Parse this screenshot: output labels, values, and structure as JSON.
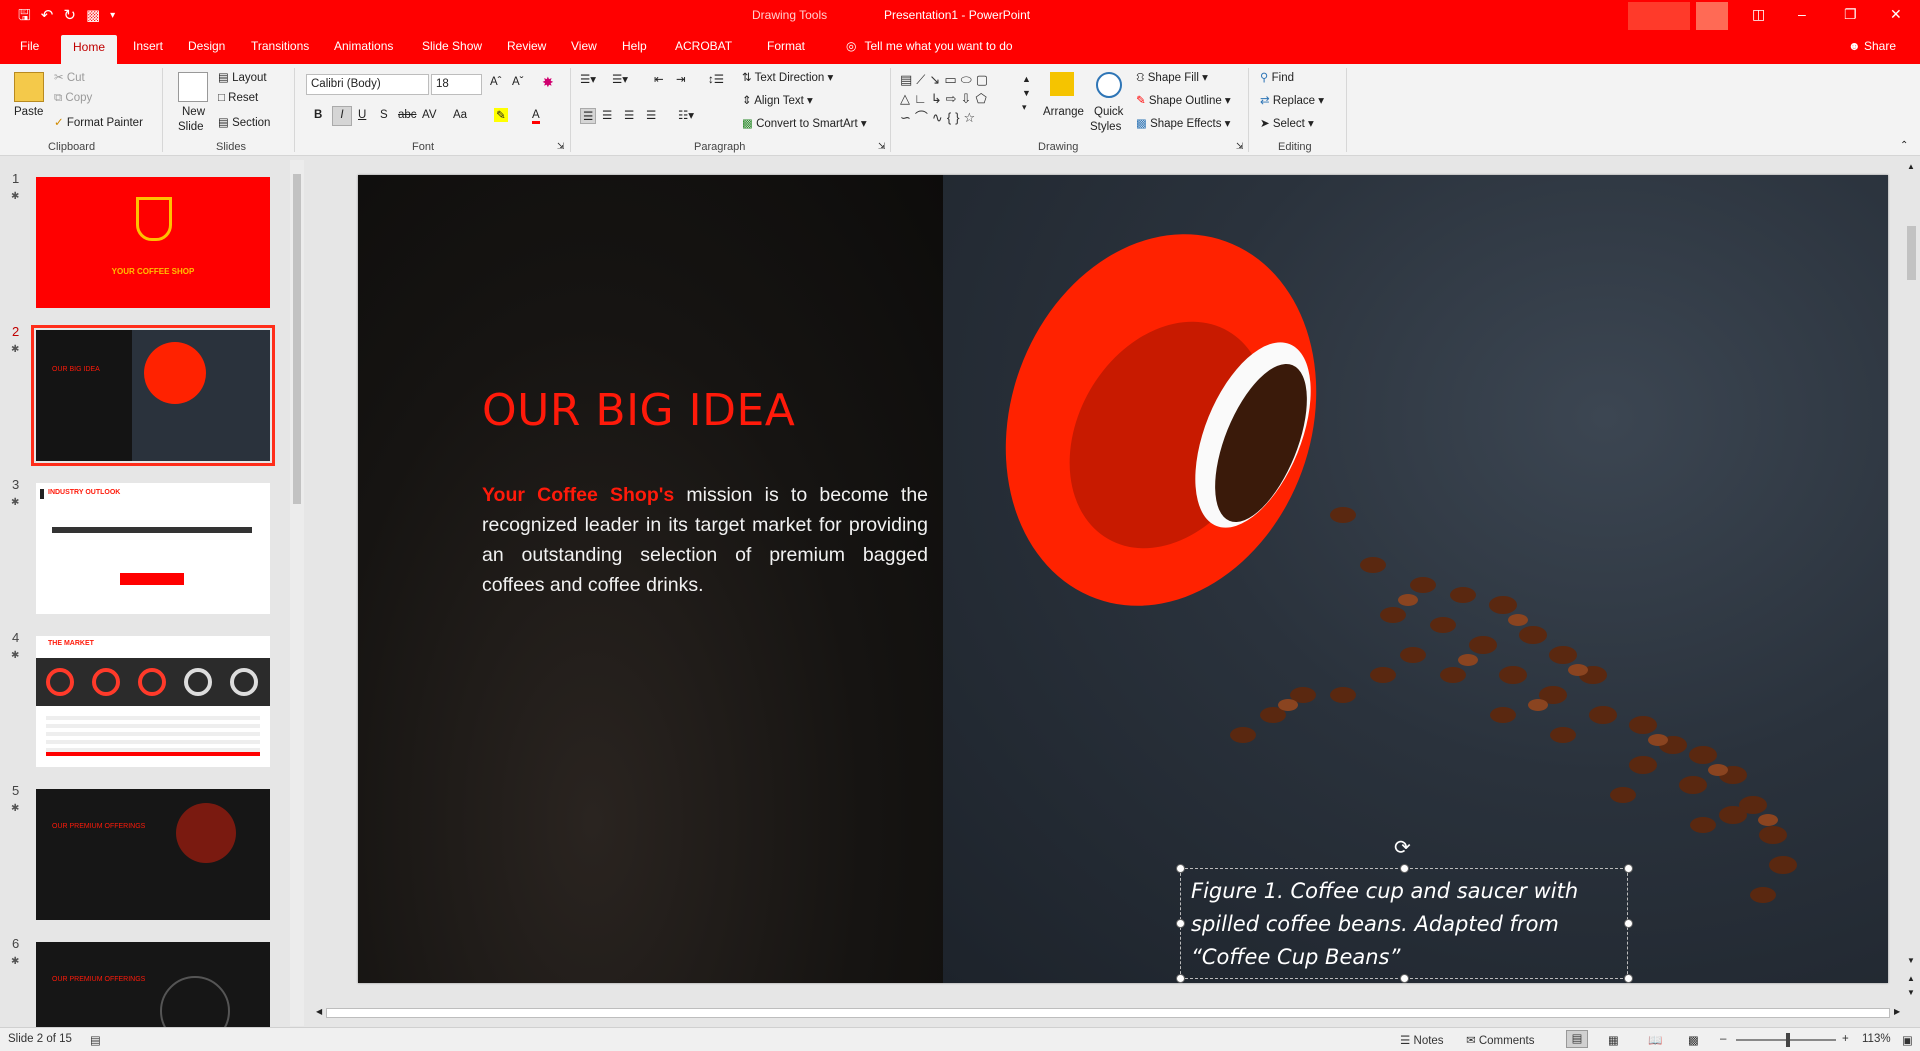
{
  "titlebar": {
    "context_tools": "Drawing Tools",
    "document_title": "Presentation1  -  PowerPoint",
    "qat": [
      "save-icon",
      "undo-icon",
      "redo-icon",
      "present-icon",
      "customize-icon"
    ]
  },
  "tabs": [
    "File",
    "Home",
    "Insert",
    "Design",
    "Transitions",
    "Animations",
    "Slide Show",
    "Review",
    "View",
    "Help",
    "ACROBAT",
    "Format"
  ],
  "active_tab": "Home",
  "tell_me": "Tell me what you want to do",
  "share": "Share",
  "ribbon": {
    "clipboard": {
      "label": "Clipboard",
      "paste": "Paste",
      "cut": "Cut",
      "copy": "Copy",
      "format_painter": "Format Painter"
    },
    "slides": {
      "label": "Slides",
      "new_slide_1": "New",
      "new_slide_2": "Slide",
      "layout": "Layout",
      "reset": "Reset",
      "section": "Section"
    },
    "font": {
      "label": "Font",
      "font_name": "Calibri (Body)",
      "font_size": "18",
      "bold": "B",
      "italic": "I",
      "underline": "U",
      "shadow": "S",
      "strike": "abc",
      "spacing": "AV",
      "case": "Aa",
      "color": "A"
    },
    "paragraph": {
      "label": "Paragraph",
      "text_direction": "Text Direction",
      "align_text": "Align Text",
      "convert_smartart": "Convert to SmartArt"
    },
    "drawing": {
      "label": "Drawing",
      "arrange": "Arrange",
      "quick_1": "Quick",
      "quick_2": "Styles",
      "shape_fill": "Shape Fill",
      "shape_outline": "Shape Outline",
      "shape_effects": "Shape Effects"
    },
    "editing": {
      "label": "Editing",
      "find": "Find",
      "replace": "Replace",
      "select": "Select"
    }
  },
  "thumbnails": [
    {
      "num": "1",
      "title": "YOUR COFFEE SHOP"
    },
    {
      "num": "2",
      "title": "OUR BIG IDEA"
    },
    {
      "num": "3",
      "title": "INDUSTRY OUTLOOK"
    },
    {
      "num": "4",
      "title": "THE MARKET"
    },
    {
      "num": "5",
      "title": "OUR PREMIUM OFFERINGS"
    },
    {
      "num": "6",
      "title": "OUR PREMIUM OFFERINGS"
    }
  ],
  "selected_slide": 2,
  "slide": {
    "title": "OUR BIG IDEA",
    "body_highlight": "Your Coffee Shop's",
    "body_rest": " mission is to become the recognized leader in its target market for providing an outstanding selection of premium bagged coffees and coffee drinks.",
    "caption": "Figure 1. Coffee cup and saucer with spilled coffee beans. Adapted from “Coffee Cup Beans”"
  },
  "statusbar": {
    "slide_info": "Slide 2 of 15",
    "notes": "Notes",
    "comments": "Comments",
    "zoom": "113%"
  },
  "colors": {
    "accent": "#ff0000",
    "slide_title": "#ff1a0a"
  }
}
